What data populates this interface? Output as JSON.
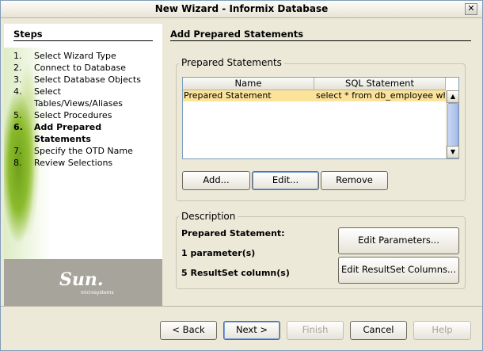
{
  "window": {
    "title": "New Wizard - Informix Database",
    "close_glyph": "✕"
  },
  "steps": {
    "heading": "Steps",
    "items": [
      {
        "num": "1.",
        "label": "Select Wizard Type"
      },
      {
        "num": "2.",
        "label": "Connect to Database"
      },
      {
        "num": "3.",
        "label": "Select Database Objects"
      },
      {
        "num": "4.",
        "label": "Select"
      },
      {
        "num": "",
        "label": "Tables/Views/Aliases"
      },
      {
        "num": "5.",
        "label": "Select Procedures"
      },
      {
        "num": "6.",
        "label": "Add Prepared Statements"
      },
      {
        "num": "7.",
        "label": "Specify the OTD Name"
      },
      {
        "num": "8.",
        "label": "Review Selections"
      }
    ],
    "current_index": 6,
    "logo_text": "Sun.",
    "logo_sub": "microsystems"
  },
  "main": {
    "title": "Add Prepared Statements",
    "prepared_group": {
      "legend": "Prepared Statements",
      "columns": [
        "Name",
        "SQL Statement"
      ],
      "rows": [
        {
          "name": "Prepared Statement",
          "sql": "select * from db_employee whe..."
        }
      ],
      "buttons": {
        "add": "Add...",
        "edit": "Edit...",
        "remove": "Remove"
      }
    },
    "description_group": {
      "legend": "Description",
      "statement_label": "Prepared Statement:",
      "param_count": "1 parameter(s)",
      "resultset_count": "5 ResultSet column(s)",
      "buttons": {
        "edit_parameters": "Edit Parameters...",
        "edit_resultset": "Edit ResultSet Columns..."
      }
    }
  },
  "nav": {
    "back": "< Back",
    "next": "Next >",
    "finish": "Finish",
    "cancel": "Cancel",
    "help": "Help"
  },
  "colors": {
    "selection": "#fbe39a",
    "window_bg": "#ece9d8"
  }
}
